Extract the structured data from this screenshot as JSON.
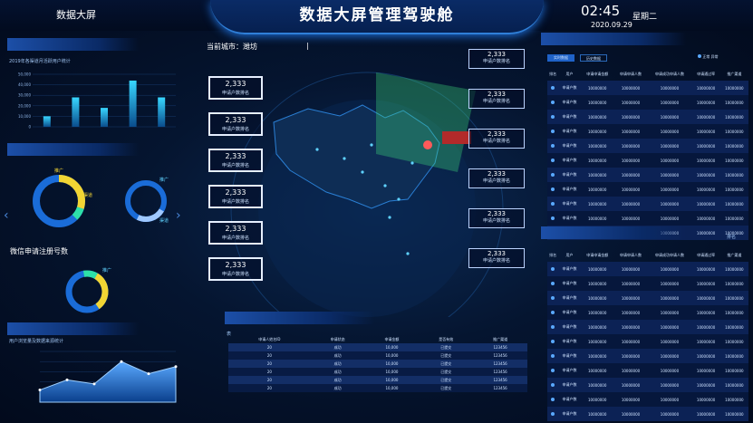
{
  "header": {
    "brand": "数据大屏",
    "title": "数据大屏管理驾驶舱",
    "time": "02:45",
    "date": "2020.09.29",
    "weekday": "星期二"
  },
  "left": {
    "bar_chart_title": "2019年各渠道月活跃用户统计",
    "bar_chart": {
      "type": "bar",
      "values": [
        10,
        28,
        18,
        44,
        28
      ],
      "ylim": [
        0,
        50
      ],
      "yticks": [
        "50,000",
        "40,000",
        "30,000",
        "20,000",
        "10,000",
        "0"
      ]
    },
    "donut_section_title": "微信申请注册号数",
    "donut1": {
      "percent_a": 30,
      "label_a": "推广",
      "label_b": "渠道"
    },
    "donut2": {
      "label_a": "推广",
      "label_b": "渠道"
    },
    "donut3": {
      "label_a": "推广"
    },
    "area_chart_title": "用户浏览量及数据来源统计",
    "area_chart": {
      "type": "area",
      "values": [
        12,
        22,
        18,
        40,
        28,
        35
      ],
      "ylim": [
        0,
        50
      ]
    }
  },
  "center": {
    "city_label": "当前城市：",
    "city_name": "潍坊",
    "left_stats": [
      {
        "value": "2,333",
        "label": "申请户数排名"
      },
      {
        "value": "2,333",
        "label": "申请户数排名"
      },
      {
        "value": "2,333",
        "label": "申请户数排名"
      },
      {
        "value": "2,333",
        "label": "申请户数排名"
      },
      {
        "value": "2,333",
        "label": "申请户数排名"
      },
      {
        "value": "2,333",
        "label": "申请户数排名"
      }
    ],
    "right_stats": [
      {
        "value": "2,333",
        "label": "申请户数排名"
      },
      {
        "value": "2,333",
        "label": "申请户数排名"
      },
      {
        "value": "2,333",
        "label": "申请户数排名"
      },
      {
        "value": "2,333",
        "label": "申请户数排名"
      },
      {
        "value": "2,333",
        "label": "申请户数排名"
      },
      {
        "value": "2,333",
        "label": "申请户数排名"
      }
    ],
    "bottom_table_title": "表",
    "bottom_table_headers": [
      "申请人姓名ID",
      "申请状态",
      "申请金额",
      "是否有效",
      "推广渠道"
    ],
    "bottom_table_rows": [
      [
        "20",
        "成功",
        "10,000",
        "已提交",
        "123456"
      ],
      [
        "20",
        "成功",
        "10,000",
        "已提交",
        "123456"
      ],
      [
        "20",
        "成功",
        "10,000",
        "已提交",
        "123456"
      ],
      [
        "20",
        "成功",
        "10,000",
        "已提交",
        "123456"
      ],
      [
        "20",
        "成功",
        "10,000",
        "已提交",
        "123456"
      ],
      [
        "20",
        "成功",
        "10,000",
        "已提交",
        "123456"
      ]
    ]
  },
  "right": {
    "tab_a": "实时数据",
    "tab_b": "历史数据",
    "legend_a": "正常",
    "legend_b": "异常",
    "table_headers": [
      "排名",
      "用户",
      "申请申请金额",
      "申请申请人数",
      "申请成功申请人数",
      "申请通过率",
      "推广渠道"
    ],
    "table_rows_top": 11,
    "table2_title": "排名",
    "table2_rows": 11,
    "cell_user": "申请户数",
    "cell_num": "10000000"
  }
}
